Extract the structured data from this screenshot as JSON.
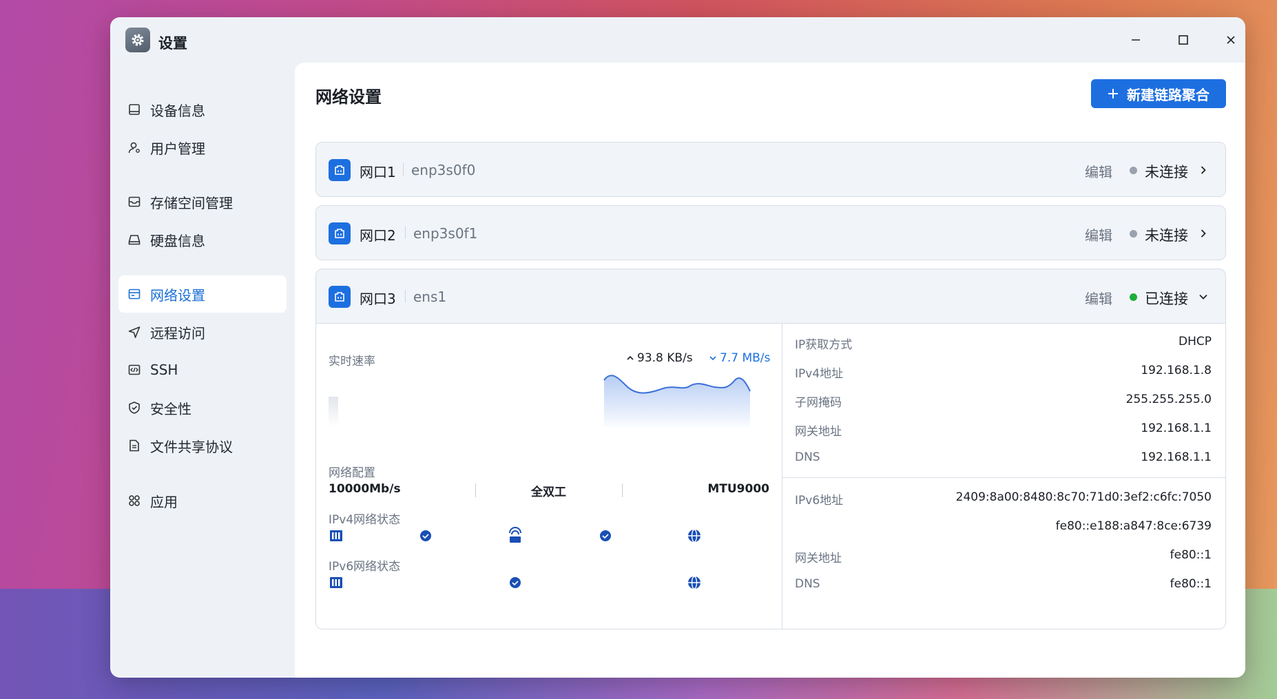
{
  "window": {
    "title": "设置",
    "icon": "gear-icon"
  },
  "sidebar": {
    "items": [
      {
        "label": "设备信息",
        "icon": "device-icon",
        "active": false
      },
      {
        "label": "用户管理",
        "icon": "user-icon",
        "active": false
      },
      {
        "label": "存储空间管理",
        "icon": "storage-icon",
        "active": false
      },
      {
        "label": "硬盘信息",
        "icon": "disk-icon",
        "active": false
      },
      {
        "label": "网络设置",
        "icon": "network-icon",
        "active": true
      },
      {
        "label": "远程访问",
        "icon": "send-icon",
        "active": false
      },
      {
        "label": "SSH",
        "icon": "code-icon",
        "active": false
      },
      {
        "label": "安全性",
        "icon": "shield-icon",
        "active": false
      },
      {
        "label": "文件共享协议",
        "icon": "file-icon",
        "active": false
      },
      {
        "label": "应用",
        "icon": "apps-icon",
        "active": false
      }
    ]
  },
  "main": {
    "title": "网络设置",
    "new_button": "新建链路聚合",
    "edit_label": "编辑",
    "ports": [
      {
        "name": "网口1",
        "device": "enp3s0f0",
        "status": "未连接",
        "connected": false
      },
      {
        "name": "网口2",
        "device": "enp3s0f1",
        "status": "未连接",
        "connected": false
      },
      {
        "name": "网口3",
        "device": "ens1",
        "status": "已连接",
        "connected": true
      }
    ],
    "detail": {
      "realtime_label": "实时速率",
      "upload": "93.8 KB/s",
      "download": "7.7 MB/s",
      "net_config_label": "网络配置",
      "speed": "10000Mb/s",
      "duplex": "全双工",
      "mtu": "MTU9000",
      "ipv4_status_label": "IPv4网络状态",
      "ipv6_status_label": "IPv6网络状态",
      "ipv4": [
        {
          "key": "IP获取方式",
          "value": "DHCP"
        },
        {
          "key": "IPv4地址",
          "value": "192.168.1.8"
        },
        {
          "key": "子网掩码",
          "value": "255.255.255.0"
        },
        {
          "key": "网关地址",
          "value": "192.168.1.1"
        },
        {
          "key": "DNS",
          "value": "192.168.1.1"
        }
      ],
      "ipv6": [
        {
          "key": "IPv6地址",
          "value": "2409:8a00:8480:8c70:71d0:3ef2:c6fc:7050"
        },
        {
          "key": "",
          "value": "fe80::e188:a847:8ce:6739"
        },
        {
          "key": "网关地址",
          "value": "fe80::1"
        },
        {
          "key": "DNS",
          "value": "fe80::1"
        }
      ]
    }
  },
  "colors": {
    "accent": "#1d6fe0",
    "connected": "#1fae3c",
    "disconnected": "#9aa2ae",
    "sidebar_bg": "#eef2f7"
  }
}
